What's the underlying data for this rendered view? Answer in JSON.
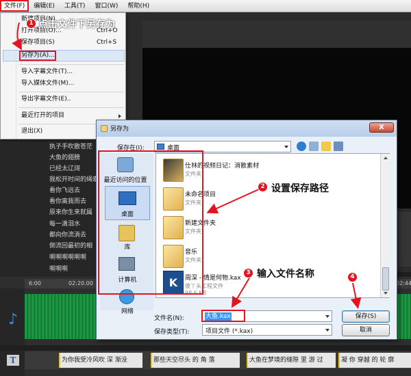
{
  "app": {
    "menubar": [
      {
        "label": "文件(F)"
      },
      {
        "label": "编辑(E)"
      },
      {
        "label": "工具(T)"
      },
      {
        "label": "窗口(W)"
      },
      {
        "label": "帮助(H)"
      }
    ]
  },
  "file_menu": {
    "items": [
      {
        "label": "新建项目(N)",
        "shortcut": ""
      },
      {
        "label": "打开项目(O)...",
        "shortcut": "Ctrl+O"
      },
      {
        "label": "保存项目(S)",
        "shortcut": "Ctrl+S"
      },
      {
        "label": "另存为(A)...",
        "shortcut": ""
      },
      {
        "label": "导入字幕文件(T)...",
        "shortcut": ""
      },
      {
        "label": "导入媒体文件(M)...",
        "shortcut": ""
      },
      {
        "label": "导出字幕文件(E)..",
        "shortcut": ""
      },
      {
        "label": "最近打开的项目",
        "shortcut": ""
      },
      {
        "label": "退出(X)",
        "shortcut": ""
      }
    ]
  },
  "lyrics": [
    "执子手吹散苍茫",
    "大鱼的翅膀",
    "已经太辽阔",
    "我松开时间的绳索",
    "看你飞远去",
    "看你离我而去",
    "原来你生来就属",
    "每一滴泪水",
    "都向你流淌去",
    "倒流回最初的相",
    "啊啊啊啊啊啊",
    "啊啊啊"
  ],
  "timeline": {
    "ruler_labels": [
      "6:00",
      "02:20.00",
      "02:44"
    ],
    "subtitle_clips": [
      "为你我受冷风吹 深 渐没",
      "那些天空尽头 的 角 落",
      "大鱼在梦境的缝隙 里 游 过",
      "凝 你 穿越 的 轮 廓"
    ]
  },
  "dialog": {
    "title": "另存为",
    "close_label": "X",
    "save_in_label": "保存在(I):",
    "save_in_value": "桌面",
    "places": [
      {
        "label": "最近访问的位置"
      },
      {
        "label": "桌面"
      },
      {
        "label": "库"
      },
      {
        "label": "计算机"
      },
      {
        "label": "网络"
      }
    ],
    "files": [
      {
        "name": "仕林的视频日记：消散素材",
        "type": "文件夹",
        "size": ""
      },
      {
        "name": "未命名项目",
        "type": "文件夹",
        "size": ""
      },
      {
        "name": "新建文件夹",
        "type": "文件夹",
        "size": ""
      },
      {
        "name": "音乐",
        "type": "文件夹",
        "size": ""
      },
      {
        "name": "周深 - 情是何物.kax",
        "type": "傻丫头工程文件",
        "size": "98.6 KB"
      }
    ],
    "filename_label": "文件名(N):",
    "filename_value": "大鱼.kax",
    "save_type_label": "保存类型(T):",
    "save_type_value": "项目文件 (*.kax)",
    "save_button": "保存(S)",
    "cancel_button": "取消"
  },
  "annotations": [
    {
      "number": "1",
      "text": "点击文件下另存为"
    },
    {
      "number": "2",
      "text": "设置保存路径"
    },
    {
      "number": "3",
      "text": "输入文件名称"
    },
    {
      "number": "4",
      "text": ""
    }
  ],
  "colors": {
    "annotation_red": "#e3141f",
    "waveform_green": "#20a94b",
    "dialog_bg": "#eaf0f8",
    "selection_blue": "#3399ff"
  }
}
